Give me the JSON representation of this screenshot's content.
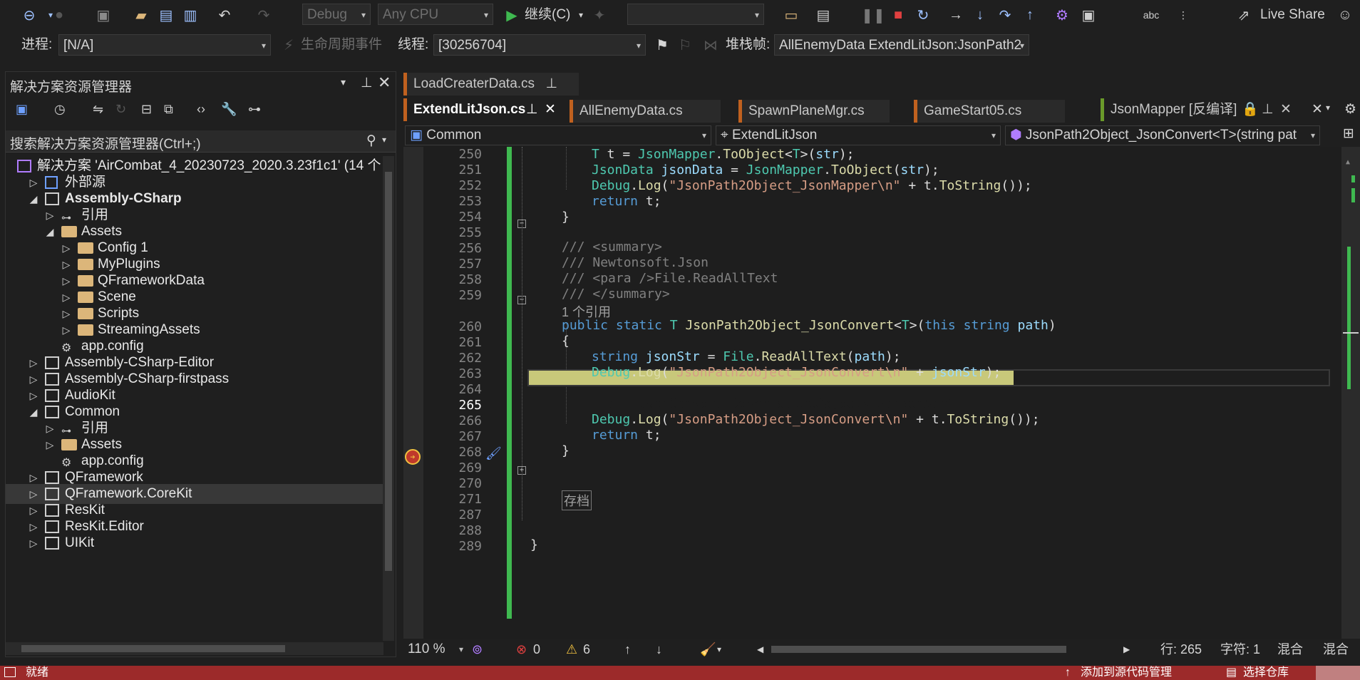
{
  "toolbar": {
    "config": "Debug",
    "platform": "Any CPU",
    "continue_label": "继续(C)",
    "live_share": "Live Share"
  },
  "debugbar": {
    "process_label": "进程:",
    "process_value": "[N/A]",
    "lifecycle_label": "生命周期事件",
    "thread_label": "线程:",
    "thread_value": "[30256704]",
    "stackframe_label": "堆栈帧:",
    "stackframe_value": "AllEnemyData ExtendLitJson:JsonPath2"
  },
  "solution_explorer": {
    "title": "解决方案资源管理器",
    "search_placeholder": "搜索解决方案资源管理器(Ctrl+;)",
    "items": [
      {
        "label": "解决方案 'AirCombat_4_20230723_2020.3.23f1c1' (14 个",
        "indent": 0,
        "icon": "solution",
        "expander": ""
      },
      {
        "label": "外部源",
        "indent": 1,
        "icon": "external",
        "expander": "▷"
      },
      {
        "label": "Assembly-CSharp",
        "indent": 1,
        "icon": "project",
        "expander": "◢",
        "bold": true
      },
      {
        "label": "引用",
        "indent": 2,
        "icon": "references",
        "expander": "▷"
      },
      {
        "label": "Assets",
        "indent": 2,
        "icon": "folder-open",
        "expander": "◢"
      },
      {
        "label": "Config 1",
        "indent": 3,
        "icon": "folder",
        "expander": "▷"
      },
      {
        "label": "MyPlugins",
        "indent": 3,
        "icon": "folder",
        "expander": "▷"
      },
      {
        "label": "QFrameworkData",
        "indent": 3,
        "icon": "folder",
        "expander": "▷"
      },
      {
        "label": "Scene",
        "indent": 3,
        "icon": "folder",
        "expander": "▷"
      },
      {
        "label": "Scripts",
        "indent": 3,
        "icon": "folder",
        "expander": "▷"
      },
      {
        "label": "StreamingAssets",
        "indent": 3,
        "icon": "folder",
        "expander": "▷"
      },
      {
        "label": "app.config",
        "indent": 2,
        "icon": "config",
        "expander": ""
      },
      {
        "label": "Assembly-CSharp-Editor",
        "indent": 1,
        "icon": "project",
        "expander": "▷"
      },
      {
        "label": "Assembly-CSharp-firstpass",
        "indent": 1,
        "icon": "project",
        "expander": "▷"
      },
      {
        "label": "AudioKit",
        "indent": 1,
        "icon": "project",
        "expander": "▷"
      },
      {
        "label": "Common",
        "indent": 1,
        "icon": "project",
        "expander": "◢"
      },
      {
        "label": "引用",
        "indent": 2,
        "icon": "references",
        "expander": "▷"
      },
      {
        "label": "Assets",
        "indent": 2,
        "icon": "folder",
        "expander": "▷"
      },
      {
        "label": "app.config",
        "indent": 2,
        "icon": "config",
        "expander": ""
      },
      {
        "label": "QFramework",
        "indent": 1,
        "icon": "project",
        "expander": "▷"
      },
      {
        "label": "QFramework.CoreKit",
        "indent": 1,
        "icon": "project",
        "expander": "▷",
        "selected": true
      },
      {
        "label": "ResKit",
        "indent": 1,
        "icon": "project",
        "expander": "▷"
      },
      {
        "label": "ResKit.Editor",
        "indent": 1,
        "icon": "project",
        "expander": "▷"
      },
      {
        "label": "UIKit",
        "indent": 1,
        "icon": "project",
        "expander": "▷"
      }
    ]
  },
  "tabs_row1": [
    {
      "label": "LoadCreaterData.cs",
      "color": "#c0611f"
    }
  ],
  "tabs_row2": [
    {
      "label": "ExtendLitJson.cs",
      "color": "#c0611f",
      "active": true
    },
    {
      "label": "AllEnemyData.cs",
      "color": "#c0611f"
    },
    {
      "label": "SpawnPlaneMgr.cs",
      "color": "#c0611f"
    },
    {
      "label": "GameStart05.cs",
      "color": "#c0611f"
    },
    {
      "label": "JsonMapper [反编译]",
      "color": "#6a9a2a"
    }
  ],
  "navbar": {
    "project": "Common",
    "class": "ExtendLitJson",
    "member": "JsonPath2Object_JsonConvert<T>(string pat"
  },
  "editor": {
    "current_line": "265",
    "reference_hint": "1 个引用",
    "collapsed_region": "存档",
    "line_numbers": [
      "250",
      "251",
      "252",
      "253",
      "254",
      "255",
      "256",
      "257",
      "258",
      "259",
      "",
      "260",
      "261",
      "262",
      "263",
      "264",
      "265",
      "266",
      "267",
      "268",
      "269",
      "270",
      "271",
      "287",
      "288",
      "289"
    ]
  },
  "editor_status": {
    "zoom": "110 %",
    "errors": "0",
    "warnings": "6",
    "line": "行: 265",
    "col": "字符: 1",
    "mix1": "混合",
    "mix2": "混合"
  },
  "statusbar": {
    "ready": "就绪",
    "add_source": "添加到源代码管理",
    "select_repo": "选择仓库"
  },
  "colors": {
    "status_bg": "#9c2a2a",
    "current_line_bg": "#c8c87a",
    "change_bar": "#3fb950"
  }
}
